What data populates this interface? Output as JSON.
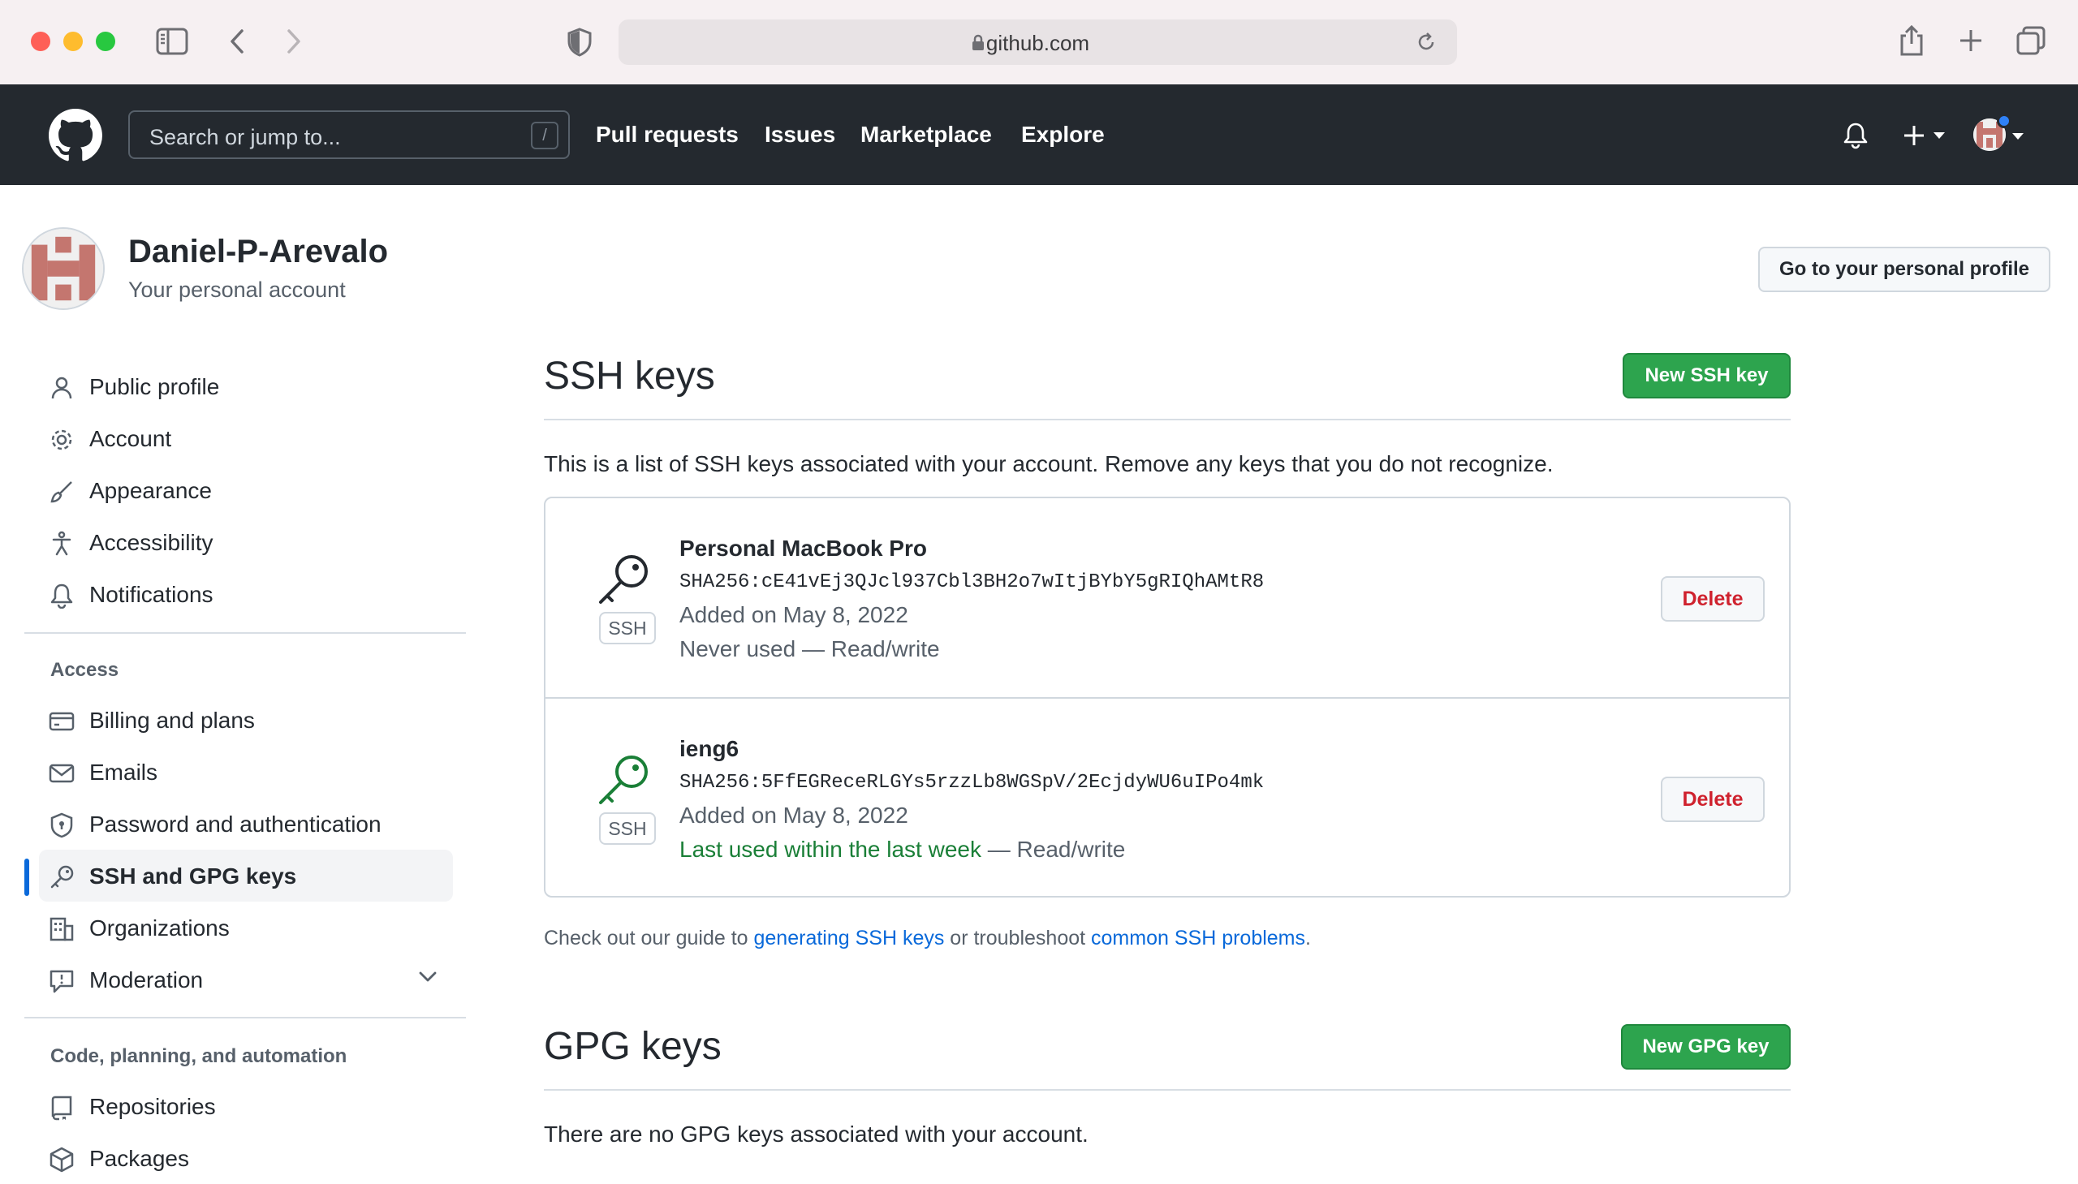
{
  "browser": {
    "url": "github.com"
  },
  "header": {
    "search_placeholder": "Search or jump to...",
    "search_shortcut": "/",
    "nav": [
      "Pull requests",
      "Issues",
      "Marketplace",
      "Explore"
    ]
  },
  "account": {
    "name": "Daniel-P-Arevalo",
    "subtitle": "Your personal account",
    "profile_button": "Go to your personal profile"
  },
  "sidebar": {
    "items": [
      {
        "label": "Public profile",
        "icon": "person-icon"
      },
      {
        "label": "Account",
        "icon": "gear-icon"
      },
      {
        "label": "Appearance",
        "icon": "paintbrush-icon"
      },
      {
        "label": "Accessibility",
        "icon": "accessibility-icon"
      },
      {
        "label": "Notifications",
        "icon": "bell-icon"
      }
    ],
    "access_heading": "Access",
    "access_items": [
      {
        "label": "Billing and plans",
        "icon": "credit-card-icon"
      },
      {
        "label": "Emails",
        "icon": "mail-icon"
      },
      {
        "label": "Password and authentication",
        "icon": "shield-lock-icon"
      },
      {
        "label": "SSH and GPG keys",
        "icon": "key-icon",
        "active": true
      },
      {
        "label": "Organizations",
        "icon": "organization-icon"
      },
      {
        "label": "Moderation",
        "icon": "report-icon"
      }
    ],
    "code_heading": "Code, planning, and automation",
    "code_items": [
      {
        "label": "Repositories",
        "icon": "repo-icon"
      },
      {
        "label": "Packages",
        "icon": "package-icon"
      }
    ]
  },
  "ssh": {
    "title": "SSH keys",
    "new_button": "New SSH key",
    "intro": "This is a list of SSH keys associated with your account. Remove any keys that you do not recognize.",
    "keys": [
      {
        "title": "Personal MacBook Pro",
        "fingerprint": "SHA256:cE41vEj3QJcl937Cbl3BH2o7wItjBYbY5gRIQhAMtR8",
        "added": "Added on May 8, 2022",
        "usage": "Never used",
        "access": " — Read/write",
        "badge": "SSH",
        "delete": "Delete",
        "key_color": "#24292f"
      },
      {
        "title": "ieng6",
        "fingerprint": "SHA256:5FfEGReceRLGYs5rzzLb8WGSpV/2EcjdyWU6uIPo4mk",
        "added": "Added on May 8, 2022",
        "usage": "Last used within the last week",
        "access": " — Read/write",
        "badge": "SSH",
        "delete": "Delete",
        "key_color": "#1a7f37"
      }
    ],
    "guide_prefix": "Check out our guide to ",
    "guide_link1": "generating SSH keys",
    "guide_middle": " or troubleshoot ",
    "guide_link2": "common SSH problems",
    "guide_suffix": "."
  },
  "gpg": {
    "title": "GPG keys",
    "new_button": "New GPG key",
    "empty": "There are no GPG keys associated with your account."
  }
}
